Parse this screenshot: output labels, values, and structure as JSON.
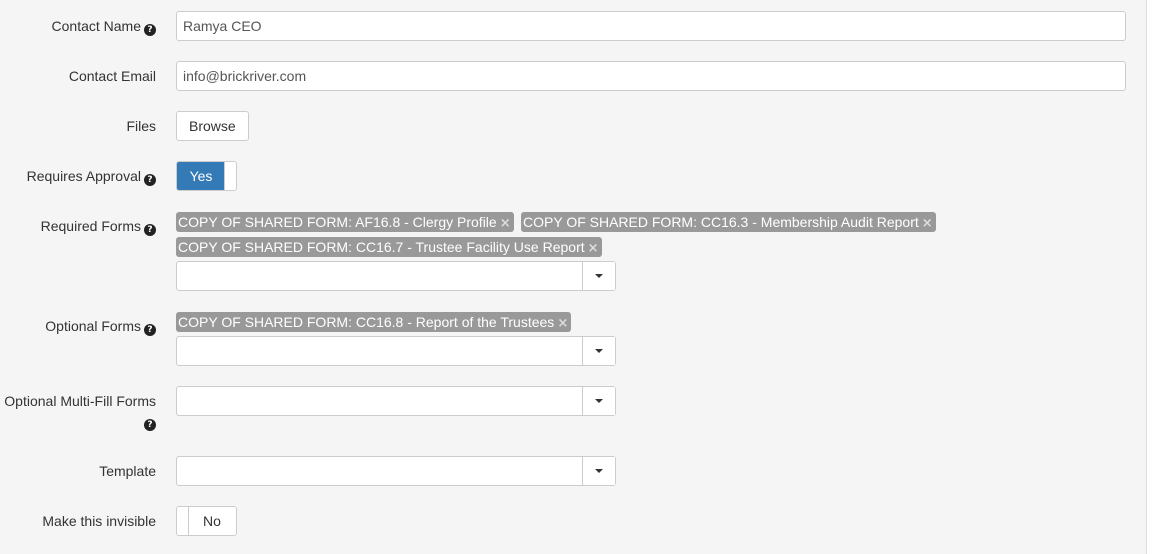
{
  "contact_name": {
    "label": "Contact Name",
    "value": "Ramya CEO",
    "help_icon": "question-circle-icon"
  },
  "contact_email": {
    "label": "Contact Email",
    "value": "info@brickriver.com"
  },
  "files": {
    "label": "Files",
    "button_label": "Browse"
  },
  "requires_approval": {
    "label": "Requires Approval",
    "toggle_label": "Yes",
    "state": "on",
    "help_icon": "question-circle-icon"
  },
  "required_forms": {
    "label": "Required Forms",
    "help_icon": "question-circle-icon",
    "tags": [
      "COPY OF SHARED FORM: AF16.8 - Clergy Profile",
      "COPY OF SHARED FORM: CC16.3 - Membership Audit Report",
      "COPY OF SHARED FORM: CC16.7 - Trustee Facility Use Report"
    ]
  },
  "optional_forms": {
    "label": "Optional Forms",
    "help_icon": "question-circle-icon",
    "tags": [
      "COPY OF SHARED FORM: CC16.8 - Report of the Trustees"
    ]
  },
  "optional_multi_fill_forms": {
    "label": "Optional Multi-Fill Forms",
    "help_icon": "question-circle-icon"
  },
  "template": {
    "label": "Template"
  },
  "make_invisible": {
    "label": "Make this invisible",
    "toggle_label": "No",
    "state": "off"
  },
  "colors": {
    "toggle_on": "#337ab7",
    "tag_bg": "#999999",
    "background": "#f5f5f5"
  }
}
